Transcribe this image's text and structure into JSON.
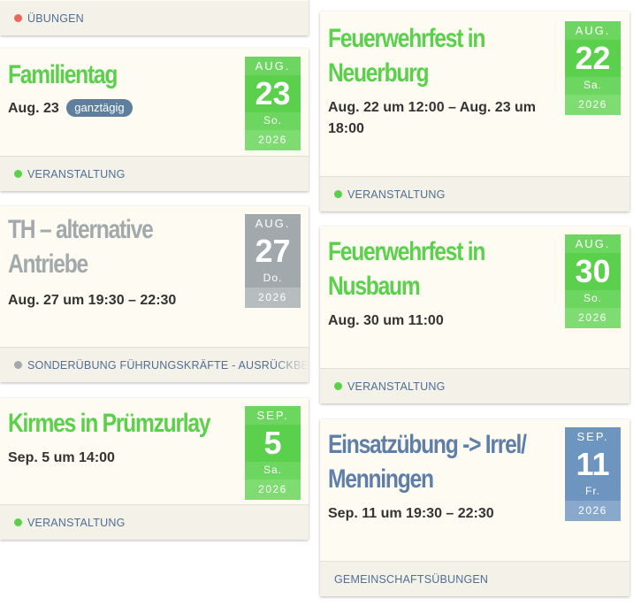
{
  "colors": {
    "green": "#5ad04c",
    "gray": "#a2a9ad",
    "blue": "#6e94c0",
    "red_dot": "#e8685c",
    "link": "#4f6f94"
  },
  "cards": {
    "top_partial": {
      "category": "ÜBUNGEN"
    },
    "familientag": {
      "title": "Familientag",
      "date_text": "Aug. 23",
      "badge": "ganztägig",
      "month": "AUG.",
      "day": "23",
      "weekday": "So.",
      "year": "2026",
      "category": "VERANSTALTUNG"
    },
    "th_alternative": {
      "title_line1": "TH – alternative",
      "title_line2": "Antriebe",
      "date_text": "Aug. 27 um 19:30 – 22:30",
      "month": "AUG.",
      "day": "27",
      "weekday": "Do.",
      "year": "2026",
      "category": "SONDERÜBUNG FÜHRUNGSKRÄFTE - AUSRÜCKBER"
    },
    "kirmes": {
      "title": "Kirmes in Prümzurlay",
      "date_text": "Sep. 5 um 14:00",
      "month": "SEP.",
      "day": "5",
      "weekday": "Sa.",
      "year": "2026",
      "category": "VERANSTALTUNG"
    },
    "feuerwehrfest_neuerburg": {
      "title_line1": "Feuerwehrfest in",
      "title_line2": "Neuerburg",
      "date_line1": "Aug. 22 um 12:00 – Aug. 23 um",
      "date_line2": "18:00",
      "month": "AUG.",
      "day": "22",
      "weekday": "Sa.",
      "year": "2026",
      "category": "VERANSTALTUNG"
    },
    "feuerwehrfest_nusbaum": {
      "title_line1": "Feuerwehrfest in",
      "title_line2": "Nusbaum",
      "date_text": "Aug. 30 um 11:00",
      "month": "AUG.",
      "day": "30",
      "weekday": "So.",
      "year": "2026",
      "category": "VERANSTALTUNG"
    },
    "einsatzuebung": {
      "title_line1": "Einsatzübung -> Irrel/",
      "title_line2": "Menningen",
      "date_text": "Sep. 11 um 19:30 – 22:30",
      "month": "SEP.",
      "day": "11",
      "weekday": "Fr.",
      "year": "2026",
      "category": "GEMEINSCHAFTSÜBUNGEN"
    }
  }
}
